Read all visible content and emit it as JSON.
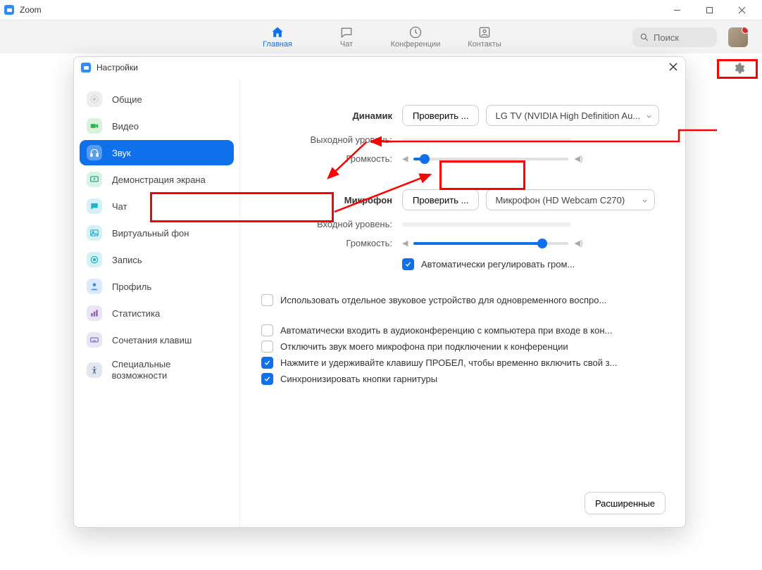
{
  "window": {
    "title": "Zoom"
  },
  "toolbar": {
    "tabs": {
      "home": "Главная",
      "chat": "Чат",
      "meetings": "Конференции",
      "contacts": "Контакты"
    },
    "searchPlaceholder": "Поиск"
  },
  "settings": {
    "title": "Настройки",
    "sidebar": {
      "general": "Общие",
      "video": "Видео",
      "audio": "Звук",
      "shareScreen": "Демонстрация экрана",
      "chat": "Чат",
      "virtualBg": "Виртуальный фон",
      "recording": "Запись",
      "profile": "Профиль",
      "statistics": "Статистика",
      "shortcuts": "Сочетания клавиш",
      "accessibility": "Специальные возможности"
    },
    "audio": {
      "speakerLabel": "Динамик",
      "testSpeaker": "Проверить ...",
      "speakerDevice": "LG TV (NVIDIA High Definition Au...",
      "outputLevel": "Выходной уровень:",
      "volume1": "Громкость:",
      "micLabel": "Микрофон",
      "testMic": "Проверить ...",
      "micDevice": "Микрофон (HD Webcam C270)",
      "inputLevel": "Входной уровень:",
      "volume2": "Громкость:",
      "autoAdjust": "Автоматически регулировать гром...",
      "separateDevice": "Использовать отдельное звуковое устройство для одновременного воспро...",
      "autoJoin": "Автоматически входить в аудиоконференцию с компьютера при входе в кон...",
      "muteMic": "Отключить звук моего микрофона при подключении к конференции",
      "pressSpace": "Нажмите и удерживайте клавишу ПРОБЕЛ, чтобы временно включить свой з...",
      "syncHeadset": "Синхронизировать кнопки гарнитуры",
      "advanced": "Расширенные"
    }
  }
}
